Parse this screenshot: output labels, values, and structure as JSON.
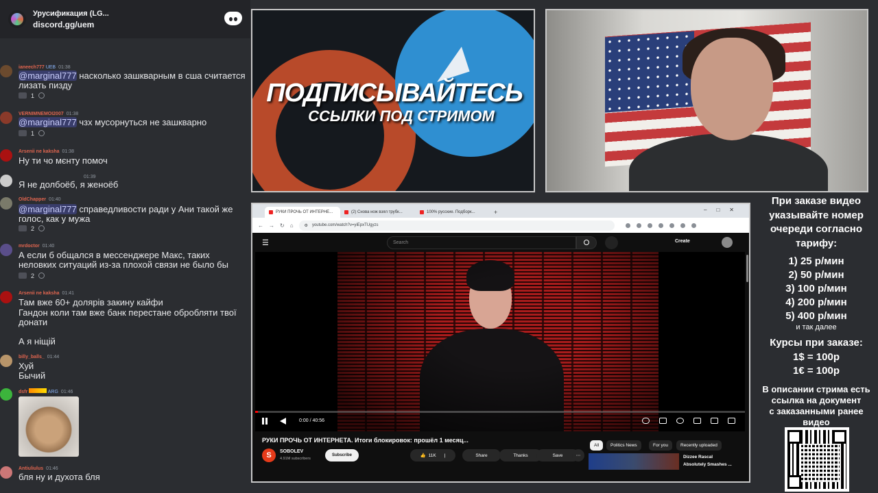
{
  "chat": {
    "header_title": "Урусификация (LG...",
    "header_sub": "discord.gg/uem",
    "messages": [
      {
        "user": "ianeech777",
        "badge": "UEB",
        "time": "01:38",
        "color": "#e0654f",
        "text_mention": "@marginal777",
        "text": " насколько зашкварным в сша считается лизать пизду",
        "react": "1"
      },
      {
        "user": "VERNIMNEMOI2007",
        "time": "01:38",
        "color": "#e0654f",
        "text_mention": "@marginal777",
        "text": " чзх мусорнуться не зашкварно",
        "react": "1"
      },
      {
        "user": "Arsenii ne kaksha",
        "time": "01:38",
        "color": "#e0654f",
        "text": "Ну ти чо мєнту помоч"
      },
      {
        "user": "",
        "time": "01:39",
        "color": "#e0654f",
        "text": "Я не долбоёб, я женоёб"
      },
      {
        "user": "OldChapper",
        "time": "01:40",
        "color": "#e0654f",
        "text_mention": "@marginal777",
        "text": " справедливости ради у Ани такой же голос, как у мужа",
        "react": "2"
      },
      {
        "user": "mrdoctor",
        "time": "01:40",
        "color": "#e0654f",
        "text": "А если б общался в мессенджере Макс, таких неловких ситуаций из-за плохой связи не было бы",
        "react": "2"
      },
      {
        "user": "Arsenii ne kaksha",
        "time": "01:41",
        "color": "#e0654f",
        "text": "Там вже 60+ долярів закину кайфи",
        "text2": "Гандон коли там вже банк перестане обробляти твої донати",
        "text3": "А я ніщій"
      },
      {
        "user": "billy_balls_",
        "time": "01:44",
        "color": "#e0654f",
        "text": "Хуй",
        "text2": "Бычий"
      },
      {
        "user": "dsfr",
        "badge": "ARG",
        "time": "01:46",
        "color": "#e0654f"
      },
      {
        "user": "Antiuliulus",
        "time": "01:46",
        "color": "#e0654f",
        "text": "бля ну и духота бля"
      }
    ]
  },
  "promo": {
    "line1": "ПОДПИСЫВАЙТЕСЬ",
    "line2": "ССЫЛКИ ПОД СТРИМОМ"
  },
  "browser": {
    "tabs": [
      "РУКИ ПРОЧЬ ОТ ИНТЕРНЕ...",
      "(2) Снова нож взял трубк...",
      "100% русские. Подборк..."
    ],
    "url": "youtube.com/watch?v=yiEpxTUgyzs",
    "search_placeholder": "Search",
    "create_label": "Create",
    "time_display": "0:00 / 40:56",
    "video_title": "РУКИ ПРОЧЬ ОТ ИНТЕРНЕТА. Итоги блокировок: прошёл 1 месяц...",
    "channel_initial": "S",
    "channel_name": "SOBOLEV",
    "channel_subs": "4.91M subscribers",
    "subscribe_label": "Subscribe",
    "likes": "11K",
    "share_label": "Share",
    "thanks_label": "Thanks",
    "save_label": "Save",
    "chips": [
      "All",
      "Politics News",
      "For you",
      "Recently uploaded"
    ],
    "rec_title_1": "Dizzee Rascal",
    "rec_title_2": "Absolutely Smashes ..."
  },
  "info": {
    "heading": [
      "При заказе видео",
      "указывайте номер",
      "очереди согласно",
      "тарифу:"
    ],
    "tariffs": [
      "1) 25 р/мин",
      "2) 50 р/мин",
      "3) 100 р/мин",
      "4) 200 р/мин",
      "5) 400 р/мин"
    ],
    "more": "и так далее",
    "rates_title": "Курсы при заказе:",
    "rates": [
      "1$ = 100р",
      "1€ = 100р"
    ],
    "description": [
      "В описании стрима есть",
      "ссылка на документ",
      "с заказанными ранее",
      "видео"
    ]
  }
}
